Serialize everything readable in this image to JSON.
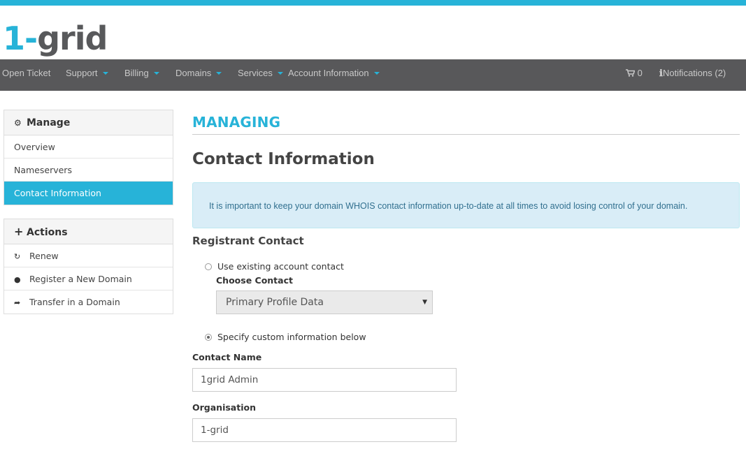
{
  "brand": {
    "logo_one": "1",
    "logo_dash": "-",
    "logo_rest": "grid",
    "accent": "#27b3d8",
    "nav_bg": "#58585a"
  },
  "nav": {
    "items": [
      {
        "label": "Open Ticket"
      },
      {
        "label": "Support"
      },
      {
        "label": "Billing"
      },
      {
        "label": "Domains"
      },
      {
        "label": "Services"
      },
      {
        "label": "Account Information"
      }
    ],
    "cart_count": "0",
    "notifications": "Notifications (2)"
  },
  "sidebar": {
    "manage": {
      "title": "Manage",
      "items": [
        {
          "label": "Overview"
        },
        {
          "label": "Nameservers"
        },
        {
          "label": "Contact Information",
          "active": true
        }
      ]
    },
    "actions": {
      "title": "Actions",
      "items": [
        {
          "label": "Renew",
          "icon": "refresh-icon"
        },
        {
          "label": "Register a New Domain",
          "icon": "globe-icon"
        },
        {
          "label": "Transfer in a Domain",
          "icon": "share-icon"
        }
      ]
    }
  },
  "main": {
    "section_title": "MANAGING",
    "page_title": "Contact Information",
    "alert": "It is important to keep your domain WHOIS contact information up-to-date at all times to avoid losing control of your domain.",
    "registrant_heading": "Registrant Contact",
    "use_existing_label": "Use existing account contact",
    "choose_contact_label": "Choose Contact",
    "choose_contact_value": "Primary Profile Data",
    "custom_info_label": "Specify custom information below",
    "fields": [
      {
        "label": "Contact Name",
        "value": "1grid Admin"
      },
      {
        "label": "Organisation",
        "value": "1-grid"
      }
    ]
  }
}
